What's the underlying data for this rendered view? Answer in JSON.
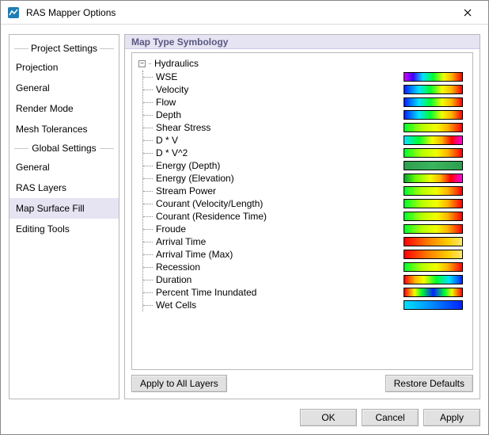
{
  "window": {
    "title": "RAS Mapper Options",
    "close_tooltip": "Close"
  },
  "sidebar": {
    "sections": [
      {
        "title": "Project Settings",
        "items": [
          {
            "label": "Projection"
          },
          {
            "label": "General"
          },
          {
            "label": "Render Mode"
          },
          {
            "label": "Mesh Tolerances"
          }
        ]
      },
      {
        "title": "Global Settings",
        "items": [
          {
            "label": "General"
          },
          {
            "label": "RAS Layers"
          },
          {
            "label": "Map Surface Fill",
            "selected": true
          },
          {
            "label": "Editing Tools"
          }
        ]
      }
    ]
  },
  "main": {
    "group_title": "Map Type Symbology",
    "tree": {
      "root_label": "Hydraulics",
      "expanded": true,
      "items": [
        {
          "label": "WSE",
          "gradient": "g-rainbow-magenta"
        },
        {
          "label": "Velocity",
          "gradient": "g-blue-red"
        },
        {
          "label": "Flow",
          "gradient": "g-blue-red"
        },
        {
          "label": "Depth",
          "gradient": "g-blue-red"
        },
        {
          "label": "Shear Stress",
          "gradient": "g-green-red"
        },
        {
          "label": "D * V",
          "gradient": "g-cyan-magenta"
        },
        {
          "label": "D * V^2",
          "gradient": "g-green-red"
        },
        {
          "label": "Energy (Depth)",
          "gradient": "g-flat-green"
        },
        {
          "label": "Energy (Elevation)",
          "gradient": "g-green-magenta"
        },
        {
          "label": "Stream Power",
          "gradient": "g-green-red"
        },
        {
          "label": "Courant (Velocity/Length)",
          "gradient": "g-green-red"
        },
        {
          "label": "Courant (Residence Time)",
          "gradient": "g-green-red"
        },
        {
          "label": "Froude",
          "gradient": "g-green-red"
        },
        {
          "label": "Arrival Time",
          "gradient": "g-red-yellow"
        },
        {
          "label": "Arrival Time (Max)",
          "gradient": "g-red-yellow"
        },
        {
          "label": "Recession",
          "gradient": "g-green-red"
        },
        {
          "label": "Duration",
          "gradient": "g-red-green-blue"
        },
        {
          "label": "Percent Time Inundated",
          "gradient": "g-red-blue-red"
        },
        {
          "label": "Wet Cells",
          "gradient": "g-cyan-blue"
        }
      ]
    },
    "buttons": {
      "apply_all": "Apply to All Layers",
      "restore_defaults": "Restore Defaults"
    }
  },
  "footer": {
    "ok": "OK",
    "cancel": "Cancel",
    "apply": "Apply"
  }
}
